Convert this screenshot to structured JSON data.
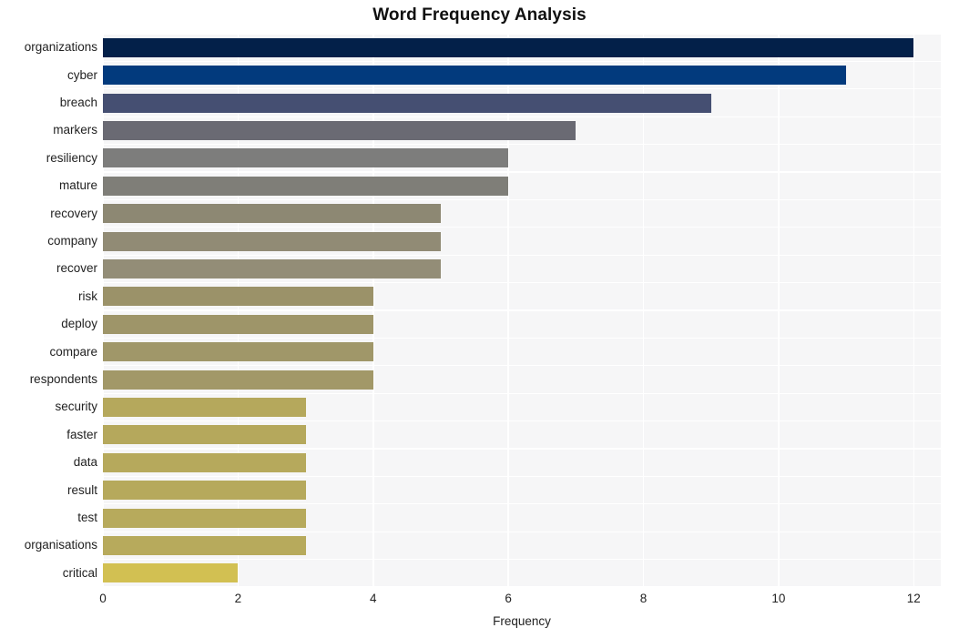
{
  "chart_data": {
    "type": "bar",
    "orientation": "horizontal",
    "title": "Word Frequency Analysis",
    "xlabel": "Frequency",
    "ylabel": "",
    "categories": [
      "organizations",
      "cyber",
      "breach",
      "markers",
      "resiliency",
      "mature",
      "recovery",
      "company",
      "recover",
      "risk",
      "deploy",
      "compare",
      "respondents",
      "security",
      "faster",
      "data",
      "result",
      "test",
      "organisations",
      "critical"
    ],
    "values": [
      12,
      11,
      9,
      7,
      6,
      6,
      5,
      5,
      5,
      4,
      4,
      4,
      4,
      3,
      3,
      3,
      3,
      3,
      3,
      2
    ],
    "bar_colors": [
      "#032049",
      "#023a7d",
      "#454f72",
      "#6a6a73",
      "#7d7d7c",
      "#7f7e78",
      "#8d8873",
      "#918b75",
      "#938d77",
      "#9b9269",
      "#9e9569",
      "#a09769",
      "#a29868",
      "#b5a85c",
      "#b5a85c",
      "#b6a95c",
      "#b6a95c",
      "#b7aa5c",
      "#b7aa5c",
      "#d2c052"
    ],
    "xlim": [
      0,
      12.4
    ],
    "xticks": [
      0,
      2,
      4,
      6,
      8,
      10,
      12
    ],
    "xtick_labels": [
      "0",
      "2",
      "4",
      "6",
      "8",
      "10",
      "12"
    ],
    "grid": true,
    "grid_color": "#ffffff",
    "plot_background": "#f6f6f7",
    "figure_background": "#ffffff",
    "legend": null
  }
}
